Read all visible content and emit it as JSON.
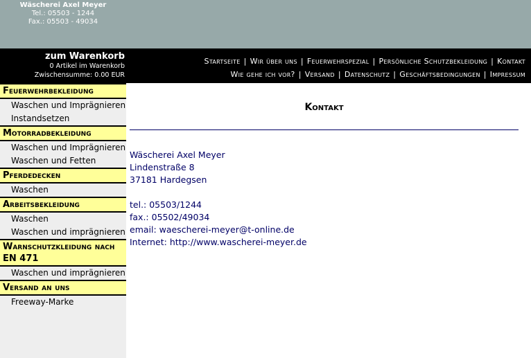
{
  "company": {
    "name": "Wäscherei Axel Meyer",
    "tel": "Tel.: 05503 - 1244",
    "fax": "Fax.: 05503 - 49034"
  },
  "cart": {
    "title": "zum Warenkorb",
    "items": "0 Artikel im Warenkorb",
    "subtotal": "Zwischensumme: 0.00 EUR"
  },
  "nav": {
    "row1": [
      "Startseite",
      "Wir über uns",
      "Feuerwehrspezial",
      "Persönliche Schutzbekleidung",
      "Kontakt"
    ],
    "row2": [
      "Wie gehe ich vor?",
      "Versand",
      "Datenschutz",
      "Geschäftsbedingungen",
      "Impressum"
    ],
    "separator": "|"
  },
  "sidebar": {
    "cats": [
      {
        "title": "Feuerwehrbekleidung",
        "items": [
          "Waschen und Imprägnieren",
          "Instandsetzen"
        ]
      },
      {
        "title": "Motorradbekleidung",
        "items": [
          "Waschen und Imprägnieren",
          "Waschen und Fetten"
        ]
      },
      {
        "title": "Pferdedecken",
        "items": [
          "Waschen"
        ]
      },
      {
        "title": "Arbeitsbekleidung",
        "items": [
          "Waschen",
          "Waschen und imprägnieren"
        ]
      },
      {
        "title": "Warnschutzkleidung nach EN 471",
        "items": [
          "Waschen und imprägnieren"
        ]
      },
      {
        "title": "Versand an uns",
        "items": [
          "Freeway-Marke"
        ]
      }
    ]
  },
  "page": {
    "title": "Kontakt"
  },
  "contact": {
    "name": "Wäscherei Axel Meyer",
    "street": "Lindenstraße 8",
    "city": "37181 Hardegsen",
    "tel": "tel.: 05503/1244",
    "fax": "fax.: 05502/49034",
    "email": "email: waescherei-meyer@t-online.de",
    "internet": "Internet: http://www.wascherei-meyer.de"
  }
}
